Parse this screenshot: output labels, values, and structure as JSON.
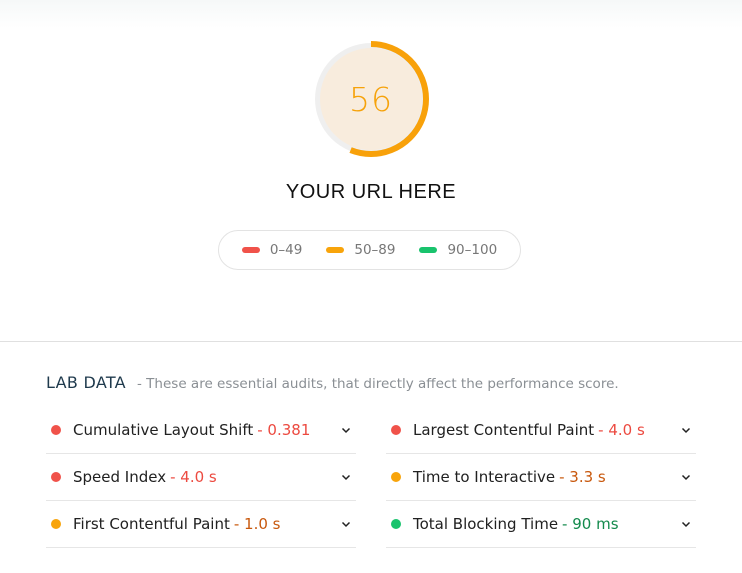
{
  "score": {
    "value": 56,
    "label": "56",
    "fraction": 0.56,
    "colors": {
      "arc": "#f8a10a",
      "track": "#efefef",
      "fill": "#f8ecdd",
      "text": "#f6a20a"
    }
  },
  "url_title": "YOUR URL HERE",
  "legend": [
    {
      "label": "0–49",
      "color": "#f0524a"
    },
    {
      "label": "50–89",
      "color": "#f8a40b"
    },
    {
      "label": "90–100",
      "color": "#19c36d"
    }
  ],
  "lab_data": {
    "title": "LAB DATA",
    "description": "- These are essential audits, that directly affect the performance score."
  },
  "metrics": [
    {
      "name": "Cumulative Layout Shift",
      "value": "- 0.381",
      "status": "fail",
      "dot_color": "#f0524a",
      "value_color": "#ec4a40"
    },
    {
      "name": "Largest Contentful Paint",
      "value": "- 4.0 s",
      "status": "fail",
      "dot_color": "#f0524a",
      "value_color": "#ec4a40"
    },
    {
      "name": "Speed Index",
      "value": "- 4.0 s",
      "status": "fail",
      "dot_color": "#f0524a",
      "value_color": "#ec4a40"
    },
    {
      "name": "Time to Interactive",
      "value": "- 3.3 s",
      "status": "average",
      "dot_color": "#f8a40b",
      "value_color": "#c8580d"
    },
    {
      "name": "First Contentful Paint",
      "value": "- 1.0 s",
      "status": "average",
      "dot_color": "#f8a40b",
      "value_color": "#c8580d"
    },
    {
      "name": "Total Blocking Time",
      "value": "- 90 ms",
      "status": "pass",
      "dot_color": "#19c36d",
      "value_color": "#138a4c"
    }
  ],
  "icons": {
    "metric_expand": "chevron-down-icon"
  }
}
